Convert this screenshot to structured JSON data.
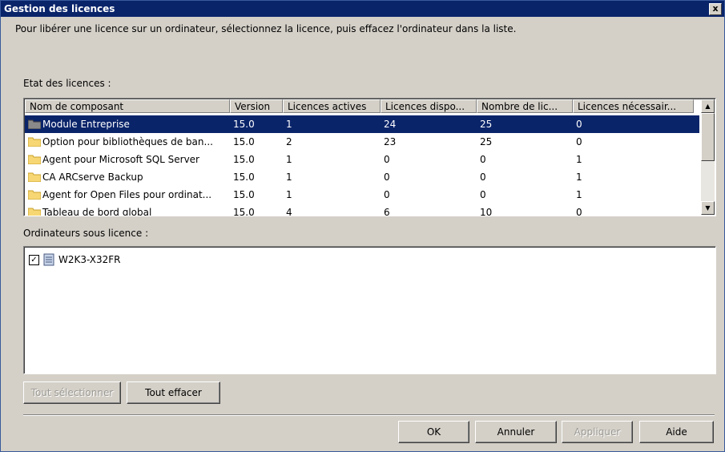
{
  "dialog": {
    "title": "Gestion des licences",
    "close_label": "x",
    "intro": "Pour libérer une licence sur un ordinateur, sélectionnez la licence, puis effacez l'ordinateur dans la liste.",
    "license_state_label": "Etat des licences :",
    "licensed_computers_label": "Ordinateurs sous licence :"
  },
  "table": {
    "columns": [
      "Nom de composant",
      "Version",
      "Licences actives",
      "Licences dispo...",
      "Nombre de lic...",
      "Licences nécessair..."
    ],
    "rows": [
      {
        "name": "Module Entreprise",
        "version": "15.0",
        "active": "1",
        "available": "24",
        "total": "25",
        "required": "0",
        "selected": true
      },
      {
        "name": "Option pour bibliothèques de ban...",
        "version": "15.0",
        "active": "2",
        "available": "23",
        "total": "25",
        "required": "0"
      },
      {
        "name": "Agent pour Microsoft SQL Server",
        "version": "15.0",
        "active": "1",
        "available": "0",
        "total": "0",
        "required": "1"
      },
      {
        "name": "CA ARCserve Backup",
        "version": "15.0",
        "active": "1",
        "available": "0",
        "total": "0",
        "required": "1"
      },
      {
        "name": "Agent for Open Files pour ordinat...",
        "version": "15.0",
        "active": "1",
        "available": "0",
        "total": "0",
        "required": "1"
      },
      {
        "name": "Tableau de bord global",
        "version": "15.0",
        "active": "4",
        "available": "6",
        "total": "10",
        "required": "0"
      }
    ]
  },
  "computers": {
    "items": [
      {
        "name": "W2K3-X32FR",
        "checked": true
      }
    ]
  },
  "buttons": {
    "select_all": "Tout sélectionner",
    "clear_all": "Tout effacer",
    "ok": "OK",
    "cancel": "Annuler",
    "apply": "Appliquer",
    "help": "Aide"
  }
}
